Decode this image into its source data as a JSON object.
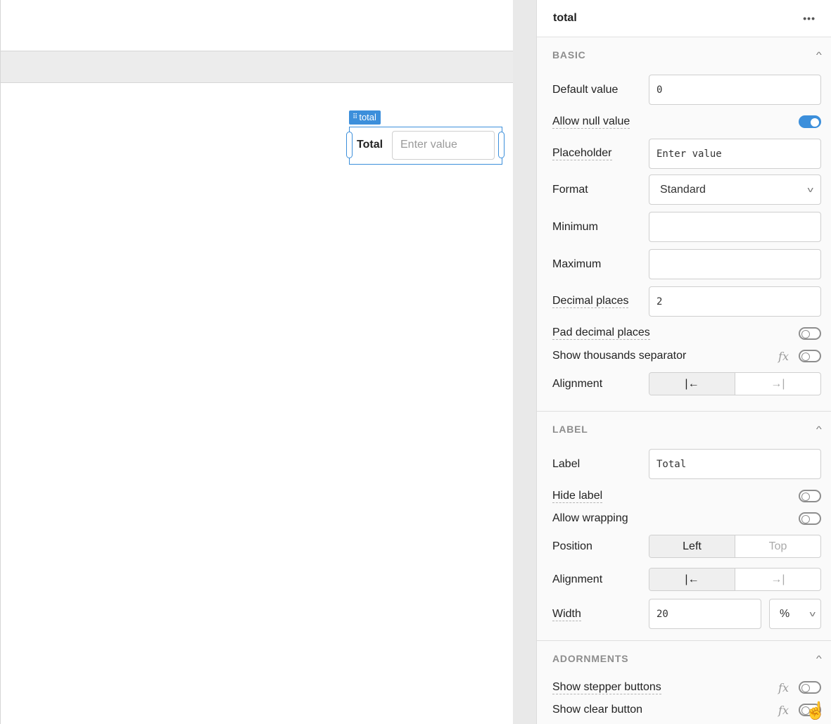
{
  "canvas": {
    "component_tag": "total",
    "component_label": "Total",
    "component_placeholder": "Enter value"
  },
  "panel": {
    "title": "total",
    "menu_icon": "more-dots-icon",
    "basic": {
      "title": "BASIC",
      "default_value_label": "Default value",
      "default_value": "0",
      "allow_null_label": "Allow null value",
      "allow_null": true,
      "placeholder_label": "Placeholder",
      "placeholder_value": "Enter value",
      "format_label": "Format",
      "format_value": "Standard",
      "minimum_label": "Minimum",
      "minimum_value": "",
      "maximum_label": "Maximum",
      "maximum_value": "",
      "decimal_label": "Decimal places",
      "decimal_value": "2",
      "pad_label": "Pad decimal places",
      "pad": false,
      "thousands_label": "Show thousands separator",
      "thousands": false,
      "alignment_label": "Alignment",
      "align_left_glyph": "|←",
      "align_right_glyph": "→|"
    },
    "label_section": {
      "title": "LABEL",
      "label_label": "Label",
      "label_value": "Total",
      "hide_label": "Hide label",
      "hide": false,
      "wrap_label": "Allow wrapping",
      "wrap": false,
      "position_label": "Position",
      "position_left": "Left",
      "position_top": "Top",
      "alignment_label": "Alignment",
      "align_left_glyph": "|←",
      "align_right_glyph": "→|",
      "width_label": "Width",
      "width_value": "20",
      "width_unit": "%"
    },
    "adornments": {
      "title": "ADORNMENTS",
      "stepper_label": "Show stepper buttons",
      "stepper": false,
      "clear_label": "Show clear button",
      "clear": false
    }
  },
  "colors": {
    "accent": "#3c8fdb"
  }
}
